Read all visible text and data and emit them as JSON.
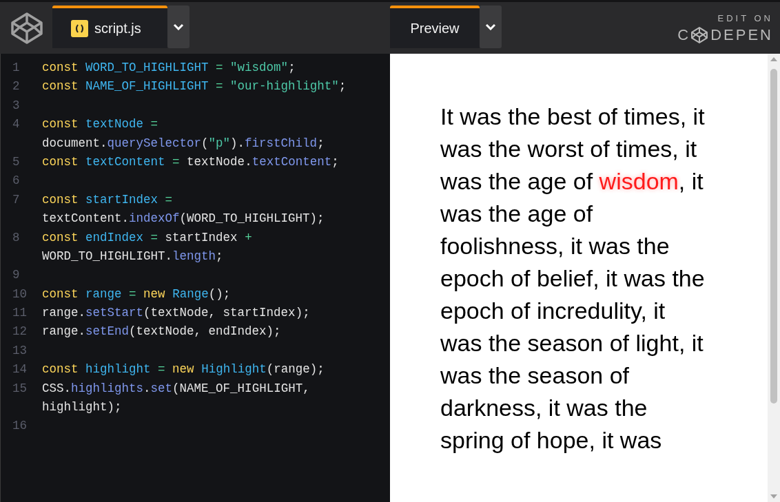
{
  "editor_tab": {
    "label": "script.js"
  },
  "preview_tab": {
    "label": "Preview"
  },
  "branding": {
    "caption": "EDIT ON",
    "wordmark_before": "C",
    "wordmark_after": "DEPEN"
  },
  "code_lines": [
    {
      "number": "1",
      "rows": [
        "const WORD_TO_HIGHLIGHT = \"wisdom\";"
      ]
    },
    {
      "number": "2",
      "rows": [
        "const NAME_OF_HIGHLIGHT = \"our-highlight\";"
      ]
    },
    {
      "number": "3"
    },
    {
      "number": "4",
      "rows": [
        "const textNode =",
        "document.querySelector(\"p\").firstChild;"
      ]
    },
    {
      "number": "5",
      "rows": [
        "const textContent = textNode.textContent;"
      ]
    },
    {
      "number": "6"
    },
    {
      "number": "7",
      "rows": [
        "const startIndex =",
        "textContent.indexOf(WORD_TO_HIGHLIGHT);"
      ]
    },
    {
      "number": "8",
      "rows": [
        "const endIndex = startIndex +",
        "WORD_TO_HIGHLIGHT.length;"
      ]
    },
    {
      "number": "9"
    },
    {
      "number": "10",
      "rows": [
        "const range = new Range();"
      ]
    },
    {
      "number": "11",
      "rows": [
        "range.setStart(textNode, startIndex);"
      ]
    },
    {
      "number": "12",
      "rows": [
        "range.setEnd(textNode, endIndex);"
      ]
    },
    {
      "number": "13"
    },
    {
      "number": "14",
      "rows": [
        "const highlight = new Highlight(range);"
      ]
    },
    {
      "number": "15",
      "rows": [
        "CSS.highlights.set(NAME_OF_HIGHLIGHT,",
        "highlight);"
      ]
    },
    {
      "number": "16"
    }
  ],
  "preview_paragraph": [
    {
      "text": "It was the best of times, it was the worst of times, it was the age of ",
      "highlighted": false
    },
    {
      "text": "wisdom",
      "highlighted": true
    },
    {
      "text": ", it was the age of foolishness, it was the epoch of belief, it was the epoch of incredulity, it was the season of light, it was the season of darkness, it was the spring of hope, it was",
      "highlighted": false
    }
  ]
}
